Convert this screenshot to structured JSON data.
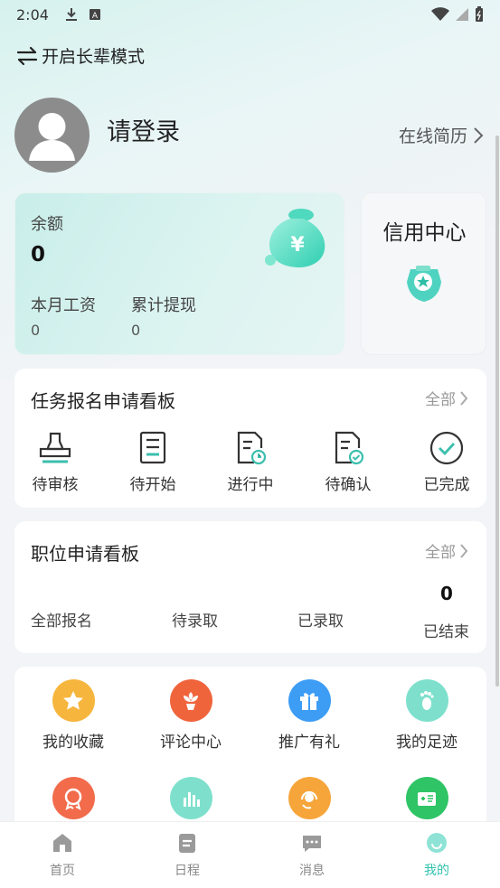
{
  "status_bar": {
    "time": "2:04"
  },
  "elder_mode": {
    "label": "开启长辈模式"
  },
  "profile": {
    "login_text": "请登录",
    "resume_link": "在线简历"
  },
  "balance": {
    "label": "余额",
    "amount": "0",
    "monthly_salary_label": "本月工资",
    "monthly_salary_value": "0",
    "total_withdraw_label": "累计提现",
    "total_withdraw_value": "0"
  },
  "credit": {
    "title": "信用中心"
  },
  "task_board": {
    "title": "任务报名申请看板",
    "all_label": "全部",
    "items": [
      {
        "label": "待审核",
        "icon": "stamp-icon"
      },
      {
        "label": "待开始",
        "icon": "document-icon"
      },
      {
        "label": "进行中",
        "icon": "document-clock-icon"
      },
      {
        "label": "待确认",
        "icon": "document-check-icon"
      },
      {
        "label": "已完成",
        "icon": "check-circle-icon"
      }
    ]
  },
  "position_board": {
    "title": "职位申请看板",
    "all_label": "全部",
    "items": [
      {
        "label": "全部报名"
      },
      {
        "label": "待录取"
      },
      {
        "label": "已录取"
      },
      {
        "label": "已结束",
        "count": "0"
      }
    ]
  },
  "services": {
    "items": [
      {
        "label": "我的收藏",
        "icon": "star-icon",
        "color": "#f6b53c"
      },
      {
        "label": "评论中心",
        "icon": "flower-icon",
        "color": "#f0643c"
      },
      {
        "label": "推广有礼",
        "icon": "gift-icon",
        "color": "#3d9df5"
      },
      {
        "label": "我的足迹",
        "icon": "footprint-icon",
        "color": "#7ee0cc"
      },
      {
        "label": "",
        "icon": "award-icon",
        "color": "#f26b4b"
      },
      {
        "label": "",
        "icon": "bar-chart-icon",
        "color": "#7ee0cc"
      },
      {
        "label": "",
        "icon": "headset-icon",
        "color": "#f6a53a"
      },
      {
        "label": "",
        "icon": "id-card-icon",
        "color": "#2fc466"
      }
    ]
  },
  "bottom_nav": {
    "items": [
      {
        "label": "首页",
        "icon": "home-icon"
      },
      {
        "label": "日程",
        "icon": "calendar-icon"
      },
      {
        "label": "消息",
        "icon": "message-icon"
      },
      {
        "label": "我的",
        "icon": "profile-icon"
      }
    ],
    "active_color": "#33c2b0"
  }
}
